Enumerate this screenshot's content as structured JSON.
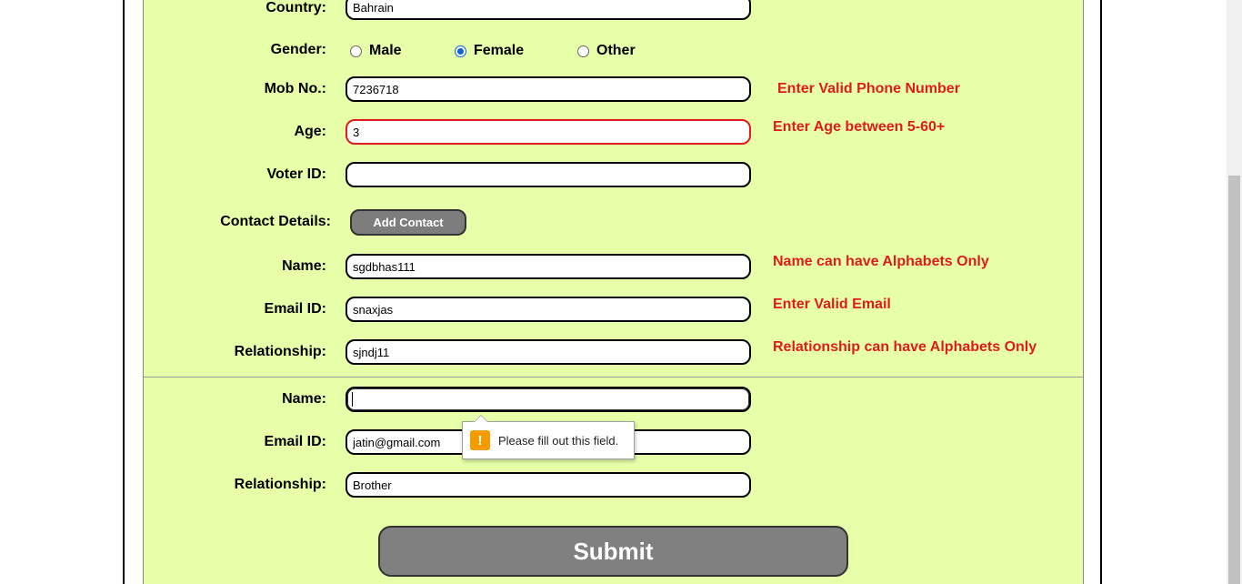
{
  "form": {
    "country": {
      "label": "Country:",
      "value": "Bahrain"
    },
    "gender": {
      "label": "Gender:",
      "options": [
        "Male",
        "Female",
        "Other"
      ],
      "selected": "Female"
    },
    "mobile": {
      "label": "Mob No.:",
      "value": "7236718",
      "error": "Enter Valid Phone Number"
    },
    "age": {
      "label": "Age:",
      "value": "3",
      "error": "Enter Age between 5-60+"
    },
    "voter_id": {
      "label": "Voter ID:",
      "value": ""
    },
    "contact_details": {
      "label": "Contact Details:",
      "add_button": "Add Contact"
    },
    "contact1": {
      "name": {
        "label": "Name:",
        "value": "sgdbhas111",
        "error": "Name can have Alphabets Only"
      },
      "email": {
        "label": "Email ID:",
        "value": "snaxjas",
        "error": "Enter Valid Email"
      },
      "relationship": {
        "label": "Relationship:",
        "value": "sjndj11",
        "error": "Relationship can have Alphabets Only"
      }
    },
    "contact2": {
      "name": {
        "label": "Name:",
        "value": ""
      },
      "email": {
        "label": "Email ID:",
        "value": "jatin@gmail.com"
      },
      "relationship": {
        "label": "Relationship:",
        "value": "Brother"
      }
    },
    "submit_label": "Submit"
  },
  "tooltip": {
    "icon": "warning-icon",
    "text": "Please fill out this field.",
    "icon_color": "#f59b00"
  },
  "colors": {
    "panel_bg": "#e6ffa8",
    "error": "#e01b1b",
    "button": "#808080",
    "radio_accent": "#0b63d6"
  }
}
